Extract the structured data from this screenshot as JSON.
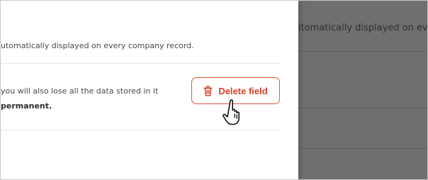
{
  "panel": {
    "description_text": "utomatically displayed on every company record.",
    "warning_line_1": "you will also lose all the data stored in it",
    "warning_line_2": "permanent.",
    "delete_button_label": "Delete field",
    "delete_icon": "trash-icon",
    "accent_color": "#d8412a"
  },
  "background_page": {
    "description_text": "itomatically displayed on eve"
  },
  "cursor": {
    "icon": "hand-pointer-icon"
  }
}
